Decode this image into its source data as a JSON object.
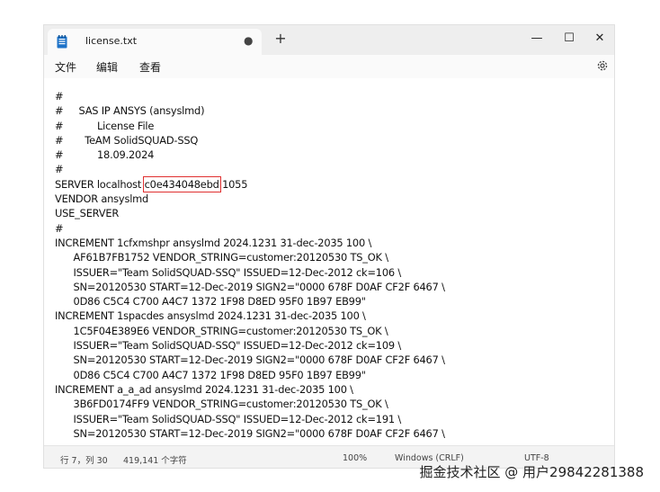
{
  "tab": {
    "title": "license.txt",
    "modified_dot": "●",
    "new_tab": "+"
  },
  "window_controls": {
    "minimize": "—",
    "maximize": "☐",
    "close": "✕"
  },
  "menu": {
    "file": "文件",
    "edit": "编辑",
    "view": "查看"
  },
  "editor": {
    "lines": [
      "#",
      "#     SAS IP ANSYS (ansyslmd)",
      "#           License File",
      "#       TeAM SolidSQUAD-SSQ",
      "#           18.09.2024",
      "#",
      "SERVER localhost ",
      "VENDOR ansyslmd",
      "USE_SERVER",
      "#",
      "INCREMENT 1cfxmshpr ansyslmd 2024.1231 31-dec-2035 100 \\",
      "      AF61B7FB1752 VENDOR_STRING=customer:20120530 TS_OK \\",
      "      ISSUER=\"Team SolidSQUAD-SSQ\" ISSUED=12-Dec-2012 ck=106 \\",
      "      SN=20120530 START=12-Dec-2019 SIGN2=\"0000 678F D0AF CF2F 6467 \\",
      "      0D86 C5C4 C700 A4C7 1372 1F98 D8ED 95F0 1B97 EB99\"",
      "INCREMENT 1spacdes ansyslmd 2024.1231 31-dec-2035 100 \\",
      "      1C5F04E389E6 VENDOR_STRING=customer:20120530 TS_OK \\",
      "      ISSUER=\"Team SolidSQUAD-SSQ\" ISSUED=12-Dec-2012 ck=109 \\",
      "      SN=20120530 START=12-Dec-2019 SIGN2=\"0000 678F D0AF CF2F 6467 \\",
      "      0D86 C5C4 C700 A4C7 1372 1F98 D8ED 95F0 1B97 EB99\"",
      "INCREMENT a_a_ad ansyslmd 2024.1231 31-dec-2035 100 \\",
      "      3B6FD0174FF9 VENDOR_STRING=customer:20120530 TS_OK \\",
      "      ISSUER=\"Team SolidSQUAD-SSQ\" ISSUED=12-Dec-2012 ck=191 \\",
      "      SN=20120530 START=12-Dec-2019 SIGN2=\"0000 678F D0AF CF2F 6467 \\"
    ],
    "server_host_id": "c0e434048ebd",
    "server_port": " 1055"
  },
  "status": {
    "position": "行 7，列 30",
    "chars": "419,141 个字符",
    "zoom": "100%",
    "line_ending": "Windows (CRLF)",
    "encoding": "UTF-8"
  },
  "watermark": "掘金技术社区 @ 用户29842281388",
  "colors": {
    "highlight_box": "#e03030"
  }
}
